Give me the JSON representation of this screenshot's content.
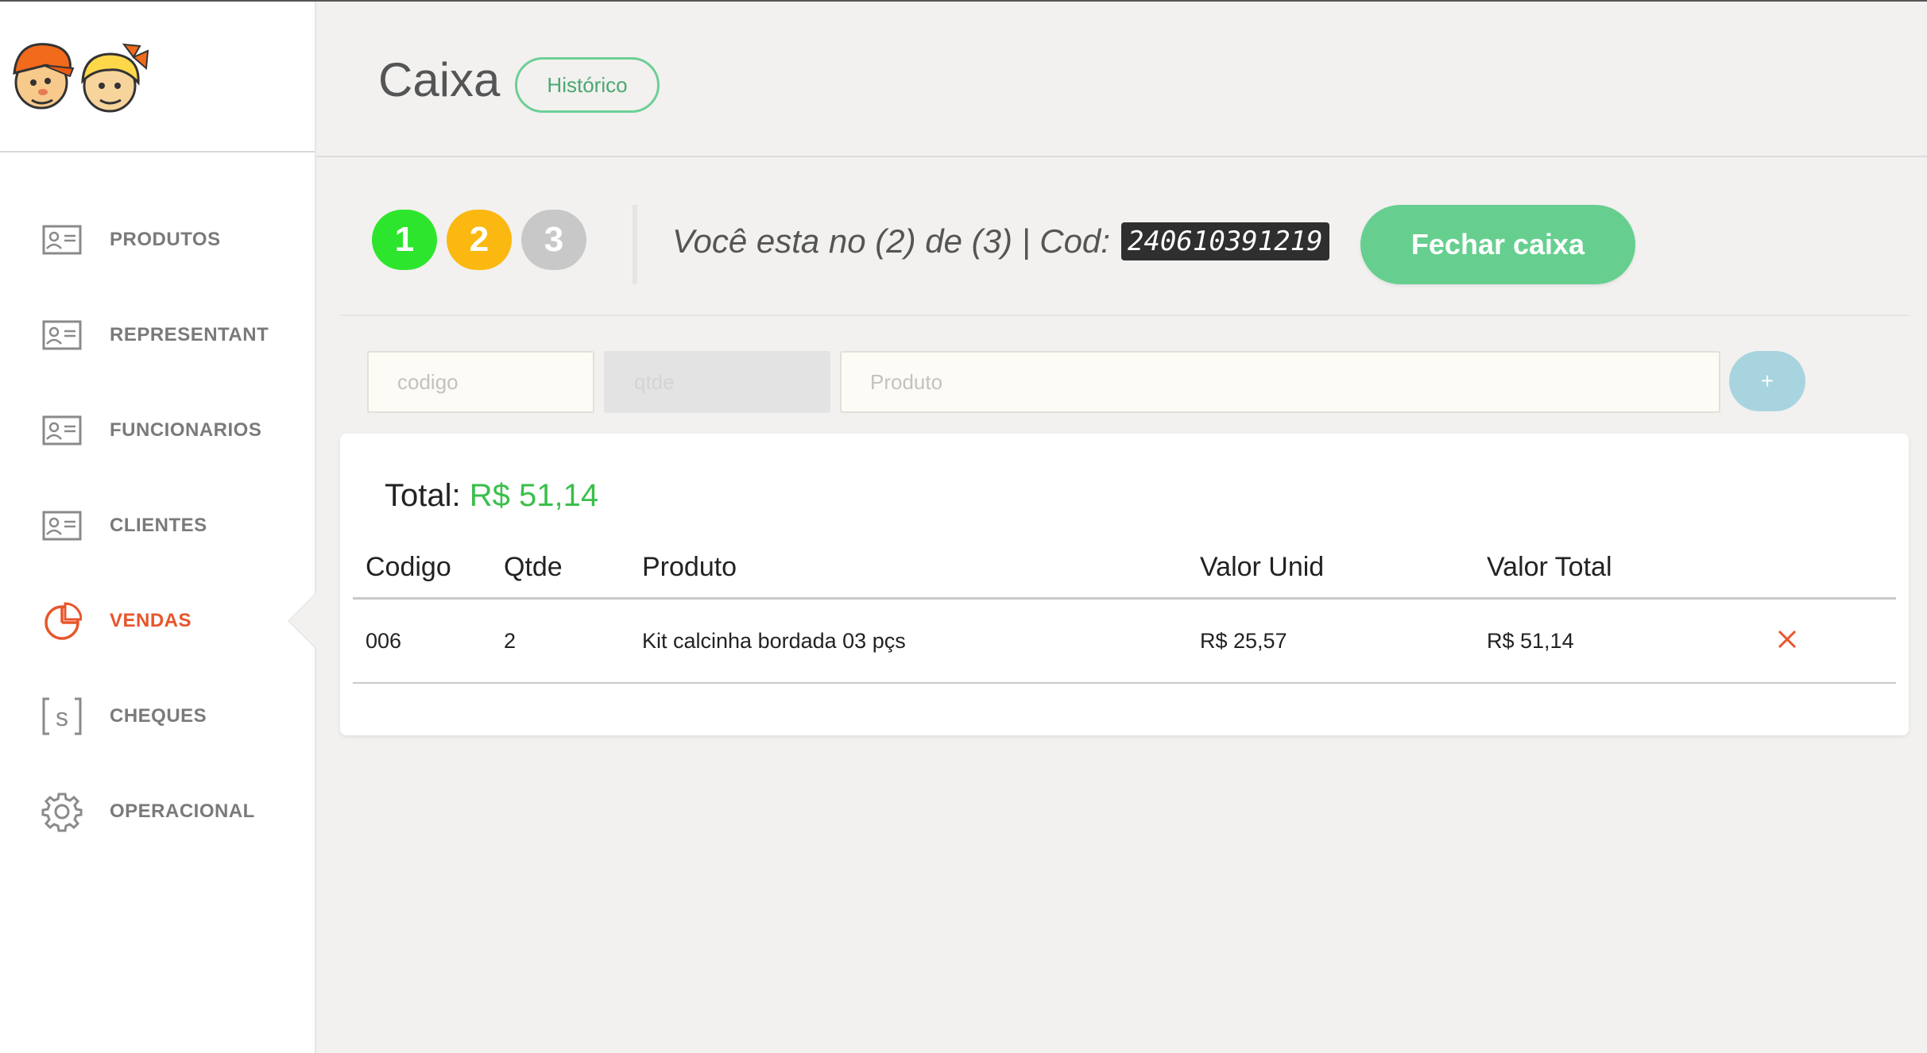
{
  "sidebar": {
    "items": [
      {
        "label": "PRODUTOS",
        "icon": "id-card-icon"
      },
      {
        "label": "REPRESENTANT",
        "icon": "id-card-icon"
      },
      {
        "label": "FUNCIONARIOS",
        "icon": "id-card-icon"
      },
      {
        "label": "CLIENTES",
        "icon": "id-card-icon"
      },
      {
        "label": "VENDAS",
        "icon": "pie-chart-icon",
        "active": true
      },
      {
        "label": "CHEQUES",
        "icon": "bracket-s-icon"
      },
      {
        "label": "OPERACIONAL",
        "icon": "gear-icon"
      }
    ]
  },
  "header": {
    "title": "Caixa",
    "history_button": "Histórico"
  },
  "steps": [
    {
      "label": "1",
      "color": "#2ee52e"
    },
    {
      "label": "2",
      "color": "#fbb811"
    },
    {
      "label": "3",
      "color": "#c8c8c8"
    }
  ],
  "status": {
    "text": "Você esta no (2) de (3) | Cod:",
    "code": "240610391219"
  },
  "close_button": "Fechar caixa",
  "form": {
    "codigo_placeholder": "codigo",
    "qtde_placeholder": "qtde",
    "produto_placeholder": "Produto",
    "add_label": "+"
  },
  "summary": {
    "total_label": "Total:",
    "total_value": "R$ 51,14"
  },
  "table": {
    "headers": [
      "Codigo",
      "Qtde",
      "Produto",
      "Valor Unid",
      "Valor Total"
    ],
    "rows": [
      {
        "codigo": "006",
        "qtde": "2",
        "produto": "Kit calcinha bordada 03 pçs",
        "valor_unid": "R$ 25,57",
        "valor_total": "R$ 51,14"
      }
    ]
  },
  "colors": {
    "accent_active": "#e8552b",
    "primary_green": "#66cf8f",
    "total_green": "#3bbf4a",
    "add_button": "#a8d4df"
  }
}
